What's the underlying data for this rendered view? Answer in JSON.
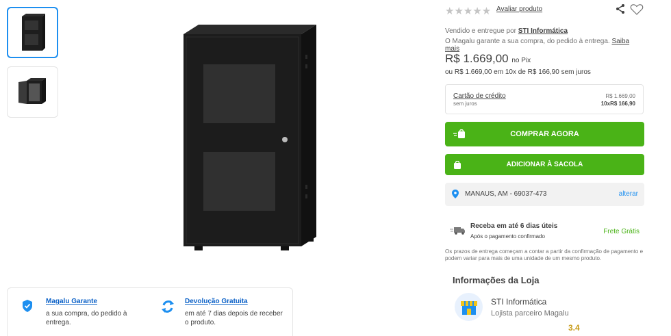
{
  "gallery": {
    "thumbnails": [
      {
        "name": "rack-front-closed",
        "selected": true
      },
      {
        "name": "rack-side-open",
        "selected": false
      }
    ],
    "main_image": "rack-cabinet-black"
  },
  "guarantee": {
    "items": [
      {
        "title": "Magalu Garante",
        "text": "a sua compra, do pedido à entrega.",
        "icon": "shield-check-icon"
      },
      {
        "title": "Devolução Gratuita",
        "text": "em até 7 dias depois de receber o produto.",
        "icon": "refresh-arrows-icon"
      }
    ]
  },
  "product": {
    "rating_stars": 0,
    "rate_link": "Avaliar produto",
    "seller_prefix": "Vendido e entregue por",
    "seller_name": "STI Informática",
    "guarantee_text": "O Magalu garante a sua compra, do pedido à entrega.",
    "guarantee_link": "Saiba mais",
    "price": "R$ 1.669,00",
    "price_suffix": "no Pix",
    "installments": "ou R$ 1.669,00 em 10x de R$ 166,90 sem juros"
  },
  "payment": {
    "title": "Cartão de crédito",
    "subtitle": "sem juros",
    "total": "R$ 1.669,00",
    "installment": "10xR$ 166,90"
  },
  "actions": {
    "buy_label": "COMPRAR AGORA",
    "bag_label": "ADICIONAR À SACOLA"
  },
  "shipping": {
    "location": "MANAUS, AM - 69037-473",
    "change_link": "alterar",
    "delivery_title": "Receba em até 6 dias úteis",
    "delivery_sub": "Após o pagamento confirmado",
    "free": "Frete Grátis",
    "note": "Os prazos de entrega começam a contar a partir da confirmação de pagamento e podem variar para mais de uma unidade de um mesmo produto."
  },
  "store": {
    "heading": "Informações da Loja",
    "name": "STI Informática",
    "subtitle": "Lojista parceiro Magalu",
    "rating": "3.4"
  },
  "colors": {
    "green": "#4ab317",
    "blue": "#1d8ff0",
    "link_blue": "#0a60c7"
  }
}
